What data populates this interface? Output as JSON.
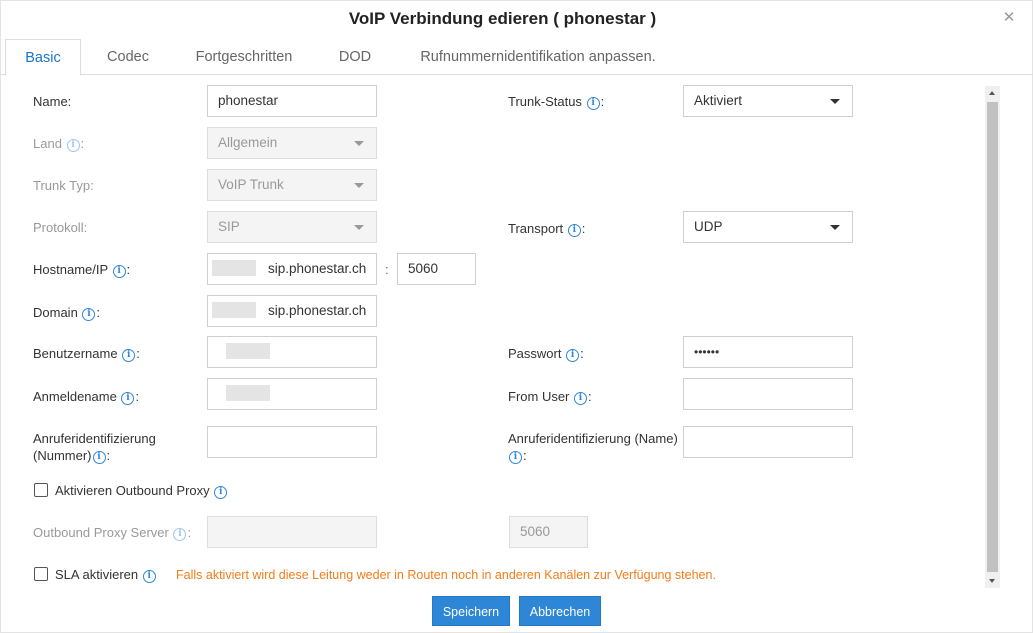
{
  "dialog": {
    "title": "VoIP Verbindung edieren ( phonestar )",
    "close_glyph": "✕"
  },
  "tabs": [
    {
      "label": "Basic",
      "active": true
    },
    {
      "label": "Codec"
    },
    {
      "label": "Fortgeschritten"
    },
    {
      "label": "DOD"
    },
    {
      "label": "Rufnummernidentifikation anpassen."
    }
  ],
  "form": {
    "name": {
      "label": "Name:",
      "value": "phonestar"
    },
    "trunk_status": {
      "label": "Trunk-Status",
      "suffix": ":",
      "value": "Aktiviert"
    },
    "land": {
      "label": "Land",
      "suffix": ":",
      "value": "Allgemein"
    },
    "trunk_typ": {
      "label": "Trunk Typ:",
      "value": "VoIP Trunk"
    },
    "protokoll": {
      "label": "Protokoll:",
      "value": "SIP"
    },
    "transport": {
      "label": "Transport",
      "suffix": ":",
      "value": "UDP"
    },
    "hostname": {
      "label": "Hostname/IP",
      "suffix": ":",
      "value": "sip.phonestar.ch",
      "separator": ":",
      "port": "5060"
    },
    "domain": {
      "label": "Domain",
      "suffix": ":",
      "value": "sip.phonestar.ch"
    },
    "benutzername": {
      "label": "Benutzername",
      "suffix": ":",
      "value": ""
    },
    "passwort": {
      "label": "Passwort",
      "suffix": ":",
      "value": "••••••"
    },
    "anmeldename": {
      "label": "Anmeldename",
      "suffix": ":",
      "value": ""
    },
    "from_user": {
      "label": "From User",
      "suffix": ":",
      "value": ""
    },
    "anrufer_nummer": {
      "label_line1": "Anruferidentifizierung",
      "label_line2": "(Nummer)",
      "suffix": ":",
      "value": ""
    },
    "anrufer_name": {
      "label_line1": "Anruferidentifizierung (Name)",
      "suffix": ":",
      "value": ""
    },
    "outbound_proxy": {
      "label": "Aktivieren Outbound Proxy",
      "checked": false
    },
    "outbound_proxy_server": {
      "label": "Outbound Proxy Server",
      "suffix": ":",
      "value": "",
      "port": "5060"
    },
    "sla": {
      "label": "SLA aktivieren",
      "checked": false,
      "warning": "Falls aktiviert wird diese Leitung weder in Routen noch in anderen Kanälen zur Verfügung stehen."
    }
  },
  "buttons": {
    "save": "Speichern",
    "cancel": "Abbrechen"
  },
  "colors": {
    "accent": "#2e87d6",
    "warning": "#f07d1a"
  }
}
